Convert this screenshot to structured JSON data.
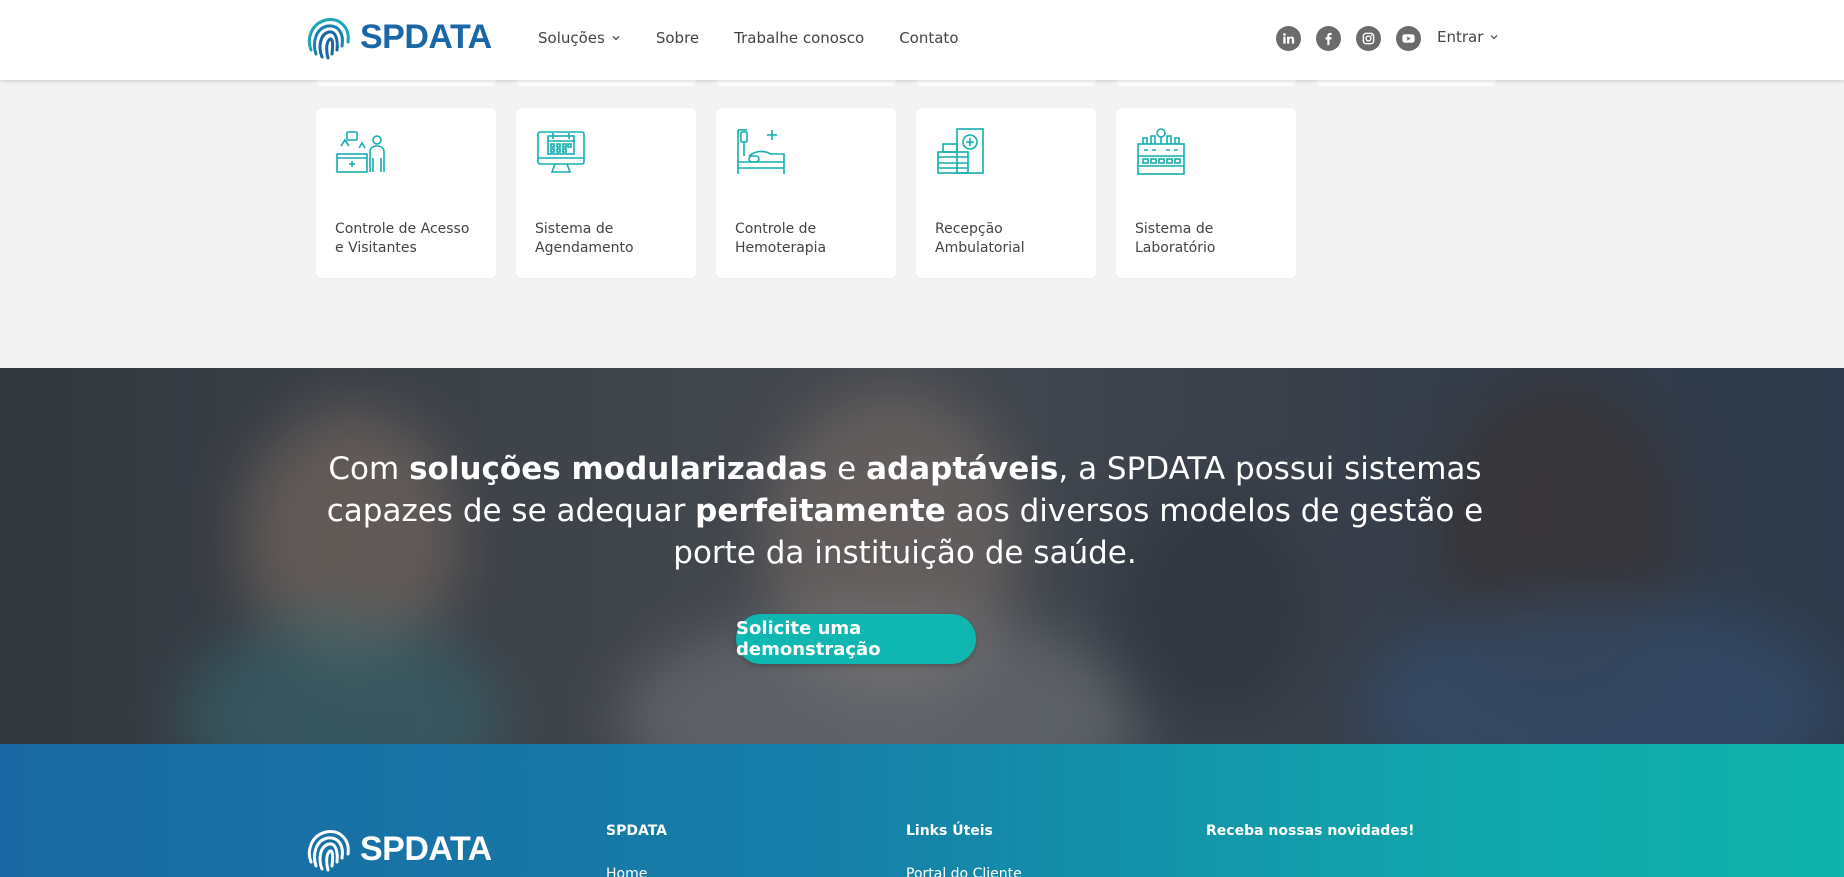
{
  "header": {
    "logo_text": "SPDATA",
    "nav": [
      {
        "label": "Soluções",
        "has_dropdown": true
      },
      {
        "label": "Sobre",
        "has_dropdown": false
      },
      {
        "label": "Trabalhe conosco",
        "has_dropdown": false
      },
      {
        "label": "Contato",
        "has_dropdown": false
      }
    ],
    "socials": [
      "linkedin-icon",
      "facebook-icon",
      "instagram-icon",
      "youtube-icon"
    ],
    "login_label": "Entrar"
  },
  "solutions": [
    {
      "label": "Controle de Acesso e Visitantes",
      "icon": "reception-desk-icon"
    },
    {
      "label": "Sistema de Agendamento",
      "icon": "calendar-monitor-icon"
    },
    {
      "label": "Controle de Hemoterapia",
      "icon": "hospital-bed-icon"
    },
    {
      "label": "Recepção Ambulatorial",
      "icon": "clinic-reception-icon"
    },
    {
      "label": "Sistema de Laboratório",
      "icon": "laboratory-icon"
    }
  ],
  "hero": {
    "line_parts": [
      {
        "text": "Com ",
        "bold": false
      },
      {
        "text": "soluções modularizadas",
        "bold": true
      },
      {
        "text": " e ",
        "bold": false
      },
      {
        "text": "adaptáveis",
        "bold": true
      },
      {
        "text": ", a SPDATA possui sistemas capazes de se adequar ",
        "bold": false
      },
      {
        "text": "perfeitamente",
        "bold": true
      },
      {
        "text": " aos diversos modelos de gestão e porte da instituição de saúde.",
        "bold": false
      }
    ],
    "cta_label": "Solicite uma demonstração"
  },
  "footer": {
    "logo_text": "SPDATA",
    "columns": [
      {
        "title": "SPDATA",
        "first_link": "Home"
      },
      {
        "title": "Links Úteis",
        "first_link": "Portal do Cliente"
      },
      {
        "title": "Receba nossas novidades!",
        "first_link": ""
      }
    ]
  },
  "colors": {
    "brand_blue": "#1a67a8",
    "brand_teal": "#10b7b0",
    "icon_teal": "#14aeb0"
  }
}
